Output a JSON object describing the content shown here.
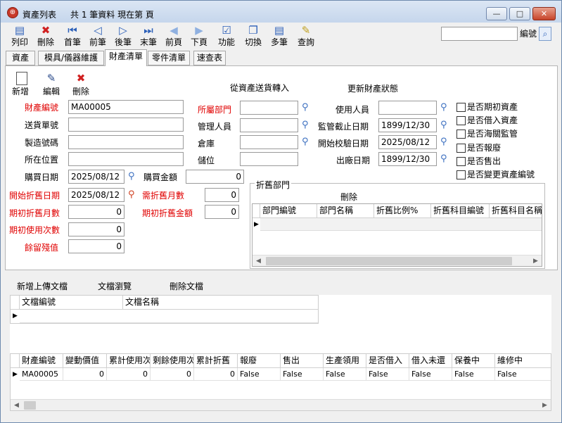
{
  "window": {
    "title": "資產列表",
    "record_info": "共 1 筆資料  現在第 頁",
    "minimize": "—",
    "maximize": "□",
    "close": "✕"
  },
  "toolbar": [
    {
      "label": "列印",
      "icon": "printer-icon"
    },
    {
      "label": "刪除",
      "icon": "delete-icon"
    },
    {
      "label": "首筆",
      "icon": "first-record-icon"
    },
    {
      "label": "前筆",
      "icon": "previous-record-icon"
    },
    {
      "label": "後筆",
      "icon": "next-record-icon"
    },
    {
      "label": "末筆",
      "icon": "last-record-icon"
    },
    {
      "label": "前頁",
      "icon": "previous-page-icon"
    },
    {
      "label": "下頁",
      "icon": "next-page-icon"
    },
    {
      "label": "功能",
      "icon": "function-icon"
    },
    {
      "label": "切換",
      "icon": "switch-icon"
    },
    {
      "label": "多筆",
      "icon": "multi-record-icon"
    },
    {
      "label": "查詢",
      "icon": "query-icon"
    }
  ],
  "search": {
    "value": "",
    "label": "編號"
  },
  "tabs": [
    "資產",
    "模具/儀器維護",
    "財產清單",
    "零件清單",
    "速查表"
  ],
  "sub_toolbar": {
    "new": "新增",
    "edit": "編輯",
    "delete": "刪除",
    "import": "從資產送貨轉入",
    "update_status": "更新財產狀態"
  },
  "form": {
    "asset_no_label": "財產編號",
    "asset_no": "MA00005",
    "delivery_no_label": "送貨單號",
    "delivery_no": "",
    "serial_label": "製造號碼",
    "serial": "",
    "location_label": "所在位置",
    "location": "",
    "purchase_date_label": "購買日期",
    "purchase_date": "2025/08/12",
    "purchase_amount_label": "購買金額",
    "purchase_amount": "0",
    "depr_start_label": "開始折舊日期",
    "depr_start": "2025/08/12",
    "depr_months_label": "需折舊月數",
    "depr_months": "0",
    "init_depr_months_label": "期初折舊月數",
    "init_depr_months": "0",
    "init_depr_amount_label": "期初折舊金額",
    "init_depr_amount": "0",
    "init_use_count_label": "期初使用次數",
    "init_use_count": "0",
    "residual_label": "餘留殘值",
    "residual": "0",
    "dept_label": "所屬部門",
    "dept": "",
    "manager_label": "管理人員",
    "manager": "",
    "warehouse_label": "倉庫",
    "warehouse": "",
    "bin_label": "儲位",
    "bin": "",
    "user_label": "使用人員",
    "user": "",
    "customs_date_label": "監管截止日期",
    "customs_date": "1899/12/30",
    "calib_date_label": "開始校驗日期",
    "calib_date": "2025/08/12",
    "factory_date_label": "出廠日期",
    "factory_date": "1899/12/30"
  },
  "checkboxes": [
    "是否期初資產",
    "是否借入資產",
    "是否海關監管",
    "是否報廢",
    "是否售出",
    "是否變更資產編號"
  ],
  "depr_dept": {
    "title": "折舊部門",
    "delete": "刪除",
    "columns": [
      "部門編號",
      "部門名稱",
      "折舊比例%",
      "折舊科目編號",
      "折舊科目名稱"
    ]
  },
  "docs": {
    "upload": "新增上傳文檔",
    "browse": "文檔瀏覽",
    "delete": "刪除文檔",
    "columns": [
      "文檔編號",
      "文檔名稱"
    ]
  },
  "bottom_grid": {
    "columns": [
      "財產編號",
      "變動價值",
      "累計使用次數",
      "剩餘使用次數",
      "累計折舊",
      "報廢",
      "售出",
      "生產領用",
      "是否借入",
      "借入未還",
      "保養中",
      "維修中"
    ],
    "rows": [
      [
        "MA00005",
        "0",
        "0",
        "0",
        "0",
        "False",
        "False",
        "False",
        "False",
        "False",
        "False",
        "False"
      ]
    ]
  }
}
